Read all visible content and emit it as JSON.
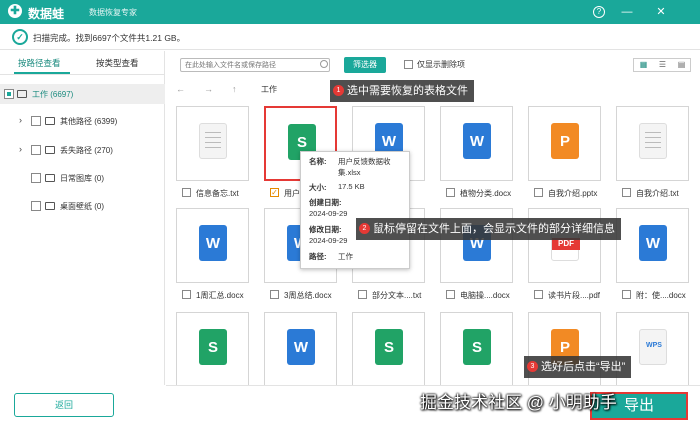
{
  "titlebar": {
    "app_name": "数据蛙",
    "subtitle": "数据恢复专家",
    "help_icon": "help-icon",
    "min_icon": "minimize-icon",
    "close_icon": "close-icon"
  },
  "status": {
    "text": "扫描完成。找到6697个文件共1.21 GB。"
  },
  "sidebar": {
    "tabs": [
      {
        "label": "按路径查看",
        "active": true
      },
      {
        "label": "按类型查看",
        "active": false
      }
    ],
    "tree": [
      {
        "label": "工作 (6697)",
        "selected": true
      },
      {
        "label": "其他路径 (6399)"
      },
      {
        "label": "丢失路径 (270)"
      },
      {
        "label": "日常图库 (0)"
      },
      {
        "label": "桌面壁纸 (0)"
      }
    ],
    "back_label": "返回"
  },
  "toolbar": {
    "search_placeholder": "在此处输入文件名或保存路径",
    "filter_label": "筛选器",
    "only_deleted_label": "仅显示删除项",
    "view_modes": [
      "grid-view-icon",
      "list-view-icon",
      "detail-view-icon"
    ]
  },
  "nav": {
    "path": "工作"
  },
  "files": [
    {
      "name": "信息备忘.txt",
      "type": "txt",
      "checked": false
    },
    {
      "name": "用户反...",
      "type": "xlsx",
      "checked": true,
      "selected": true
    },
    {
      "name": ".docx",
      "type": "docx",
      "checked": false
    },
    {
      "name": "植物分类.docx",
      "type": "docx",
      "checked": false
    },
    {
      "name": "自我介绍.pptx",
      "type": "pptx",
      "checked": false
    },
    {
      "name": "自我介绍.txt",
      "type": "txt",
      "checked": false
    },
    {
      "name": "1周汇总.docx",
      "type": "docx",
      "checked": false
    },
    {
      "name": "3周总结.docx",
      "type": "docx",
      "checked": false
    },
    {
      "name": "部分文本....txt",
      "type": "txt",
      "checked": false
    },
    {
      "name": "电脑操....docx",
      "type": "docx",
      "checked": false
    },
    {
      "name": "读书片段....pdf",
      "type": "pdf",
      "checked": false
    },
    {
      "name": "附：使....docx",
      "type": "docx",
      "checked": false
    },
    {
      "name": "",
      "type": "xlsx",
      "checked": false
    },
    {
      "name": "",
      "type": "docx",
      "checked": false
    },
    {
      "name": "",
      "type": "xlsx",
      "checked": false
    },
    {
      "name": "",
      "type": "xlsx",
      "checked": false
    },
    {
      "name": "",
      "type": "pptx",
      "checked": false
    },
    {
      "name": "",
      "type": "wps",
      "checked": false
    }
  ],
  "file_icons": {
    "txt": "",
    "xlsx": "S",
    "docx": "W",
    "pptx": "P",
    "pdf": "PDF",
    "wps": "WPS"
  },
  "tooltip": {
    "name_label": "名称:",
    "name_value": "用户反馈数据收集.xlsx",
    "size_label": "大小:",
    "size_value": "17.5 KB",
    "created_label": "创建日期:",
    "created_value": "2024-09-29",
    "modified_label": "修改日期:",
    "modified_value": "2024-09-29",
    "path_label": "路径:",
    "path_value": "工作"
  },
  "annotations": [
    {
      "num": "1",
      "text": "选中需要恢复的表格文件"
    },
    {
      "num": "2",
      "text": "鼠标停留在文件上面，会显示文件的部分详细信息"
    },
    {
      "num": "3",
      "text": "选好后点击“导出”"
    }
  ],
  "footer": {
    "export_label": "导出"
  },
  "watermark": "掘金技术社区 @ 小明助手",
  "colors": {
    "accent": "#1aa89a",
    "highlight": "#e53935"
  }
}
